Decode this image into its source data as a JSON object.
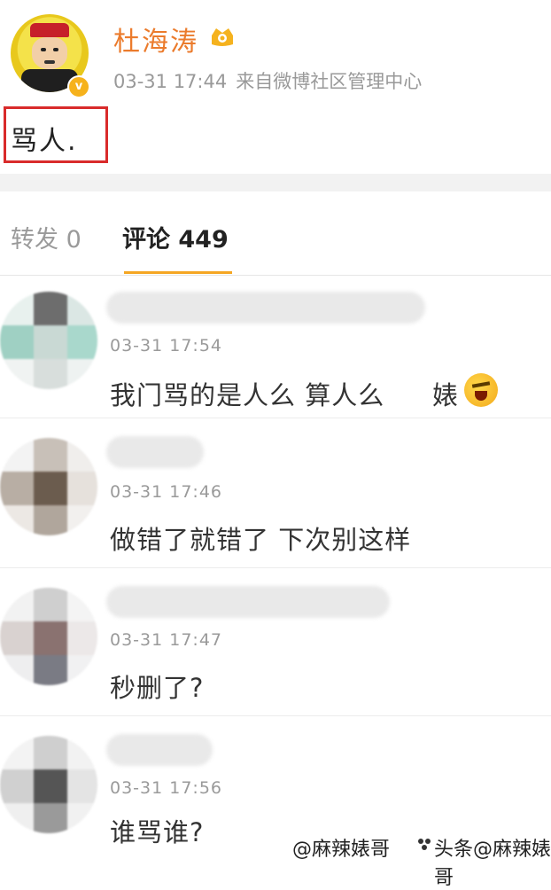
{
  "post": {
    "username": "杜海涛",
    "time": "03-31 17:44",
    "source": "来自微博社区管理中心",
    "content": "骂人."
  },
  "tabs": {
    "repost": "转发 0",
    "comment": "评论 449"
  },
  "comments": [
    {
      "time": "03-31 17:54",
      "text": "我门骂的是人么 算人么",
      "emoji_text": "婊"
    },
    {
      "time": "03-31 17:46",
      "text": "做错了就错了 下次别这样"
    },
    {
      "time": "03-31 17:47",
      "text": "秒删了?"
    },
    {
      "time": "03-31 17:56",
      "text": "谁骂谁?"
    }
  ],
  "watermarks": [
    "@麻辣婊哥",
    "头条@麻辣婊哥"
  ],
  "icons": [
    "verified-badge-icon",
    "user-level-icon",
    "angry-emoji-icon"
  ]
}
